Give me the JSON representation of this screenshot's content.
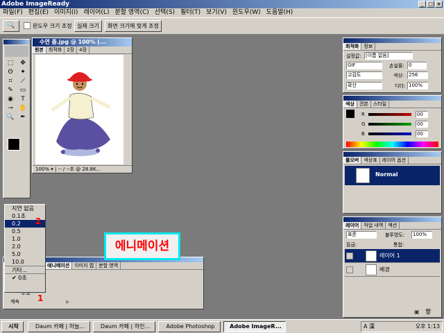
{
  "app": {
    "title": "Adobe ImageReady"
  },
  "menu": [
    "파일(F)",
    "편집(E)",
    "이미지(I)",
    "레이어(L)",
    "분할 영역(C)",
    "선택(S)",
    "필터(T)",
    "보기(V)",
    "윈도우(W)",
    "도움말(H)"
  ],
  "options_bar": {
    "resize_windows_label": "윈도우 크기 조정",
    "actual_size_button": "실제 크기",
    "fit_screen_button": "화면 크기에 맞게 조정"
  },
  "document": {
    "title": "수연 춤.jpg @ 100% (...",
    "tabs": [
      "원본",
      "최적화",
      "2장",
      "4장"
    ],
    "zoom": "100%",
    "status_info": "-- / --초 @ 28.8K..."
  },
  "optimize_panel": {
    "tabs": [
      "최적화",
      "정보"
    ],
    "settings_label": "설정값:",
    "settings_value": "[이름 없음]",
    "format": "GIF",
    "lossy_label": "손실률:",
    "lossy_value": "0",
    "palette": "고감도",
    "colors_label": "색상:",
    "colors_value": "256",
    "dither_method": "확산",
    "dither_label": "디더:",
    "dither_value": "100%"
  },
  "color_panel": {
    "tabs": [
      "색상",
      "견본",
      "스타일"
    ],
    "channels": [
      {
        "name": "R",
        "value": "00"
      },
      {
        "name": "G",
        "value": "00"
      },
      {
        "name": "B",
        "value": "00"
      }
    ]
  },
  "rollover_panel": {
    "tabs": [
      "롤오버",
      "색상표",
      "레이어 옵션"
    ],
    "state": "Normal"
  },
  "layers_panel": {
    "tabs": [
      "레이어",
      "작업 내역",
      "액션"
    ],
    "blend_mode": "표준",
    "opacity_label": "불투명도:",
    "opacity_value": "100%",
    "lock_label": "잠금:",
    "unify_label": "통합:",
    "layers": [
      {
        "name": "레이어 1",
        "selected": true
      },
      {
        "name": "배경",
        "selected": false
      }
    ]
  },
  "delay_menu": {
    "items": [
      "지연 없음",
      "0.1초",
      "0.2",
      "0.5",
      "1.0",
      "2.0",
      "5.0",
      "10.0",
      "기타...",
      "0초"
    ],
    "selected": "0.2",
    "checked": "0초"
  },
  "annotations": {
    "marker_1": "1",
    "marker_2": "2",
    "animation_label": "에니메이션"
  },
  "animation_panel": {
    "tabs": [
      "애니메이션",
      "이미지 맵",
      "분할 영역"
    ],
    "frame_delay": "0.초",
    "loop": "계속"
  },
  "taskbar": {
    "start": "시작",
    "items": [
      "Daum 카페 | 하늘...",
      "Daum 카페 | 하인...",
      "Adobe Photoshop",
      "Adobe ImageR..."
    ],
    "active_index": 3,
    "tray_lang": "A 漢",
    "clock": "오후 1:13"
  },
  "colors": {
    "title_start": "#0a246a",
    "title_end": "#a6caf0",
    "cyan_highlight": "#00e8f0",
    "red_text": "#ff0000",
    "selected_layer": "#0a246a"
  }
}
